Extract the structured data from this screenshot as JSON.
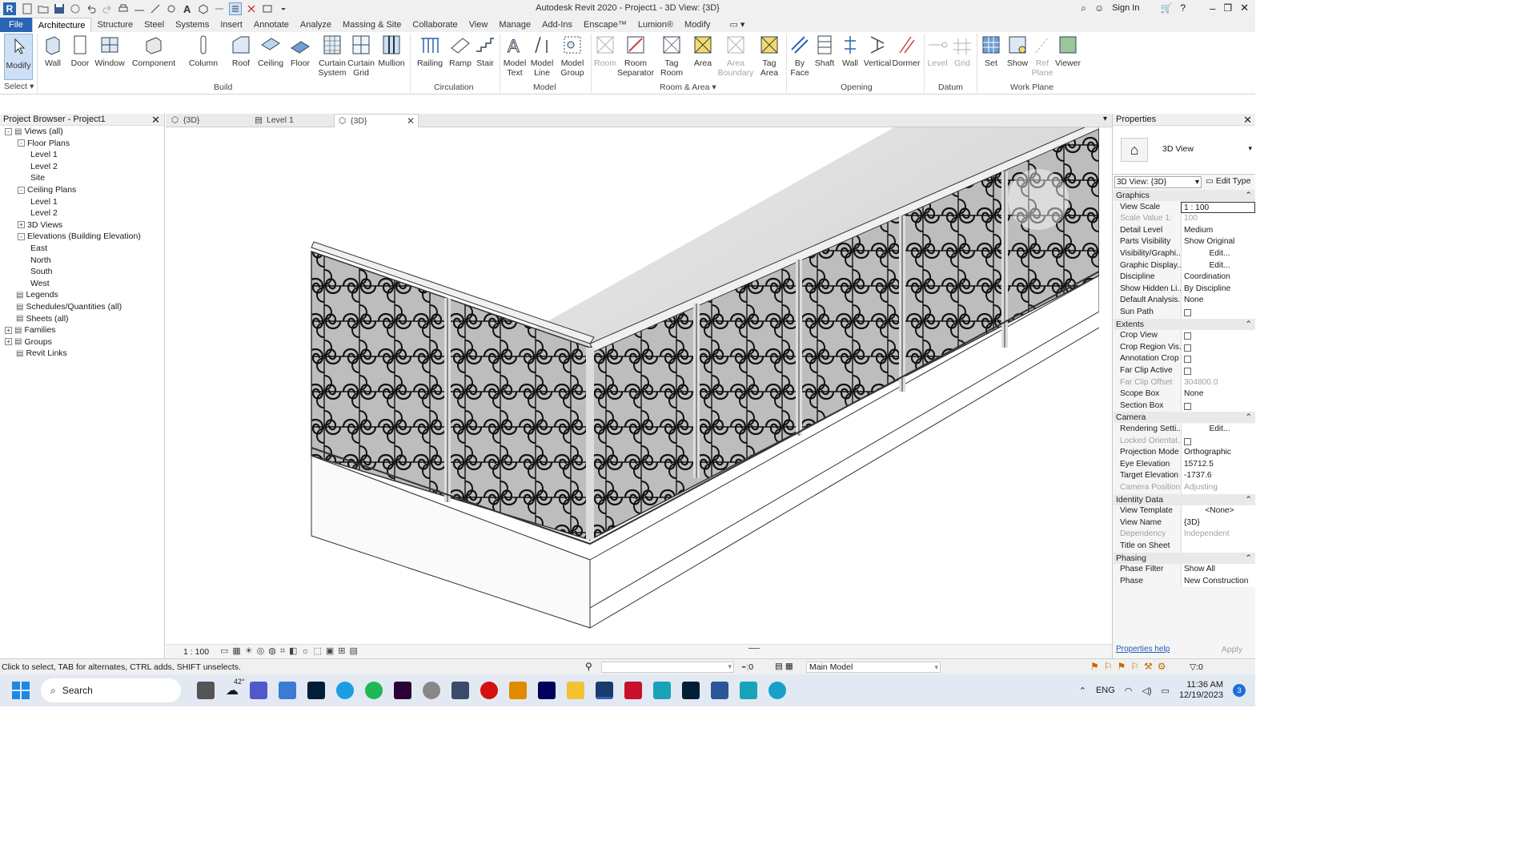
{
  "title_bar": {
    "title": "Autodesk Revit 2020 - Project1 - 3D View: {3D}",
    "sign_in": "Sign In"
  },
  "menu": {
    "tabs": [
      "File",
      "Architecture",
      "Structure",
      "Steel",
      "Systems",
      "Insert",
      "Annotate",
      "Analyze",
      "Massing & Site",
      "Collaborate",
      "View",
      "Manage",
      "Add-Ins",
      "Enscape™",
      "Lumion®",
      "Modify"
    ],
    "active": "Architecture"
  },
  "ribbon": {
    "select": {
      "modify": "Modify",
      "select_label": "Select"
    },
    "build": {
      "label": "Build",
      "items": [
        "Wall",
        "Door",
        "Window",
        "Component",
        "Column",
        "Roof",
        "Ceiling",
        "Floor",
        "Curtain System",
        "Curtain Grid",
        "Mullion"
      ]
    },
    "circulation": {
      "label": "Circulation",
      "items": [
        "Railing",
        "Ramp",
        "Stair"
      ]
    },
    "model": {
      "label": "Model",
      "items": [
        "Model Text",
        "Model Line",
        "Model Group"
      ]
    },
    "room_area": {
      "label": "Room & Area",
      "items": [
        "Room",
        "Room Separator",
        "Tag Room",
        "Area",
        "Area Boundary",
        "Tag Area"
      ]
    },
    "opening": {
      "label": "Opening",
      "items": [
        "By Face",
        "Shaft",
        "Wall",
        "Vertical",
        "Dormer"
      ]
    },
    "datum": {
      "label": "Datum",
      "items": [
        "Level",
        "Grid"
      ]
    },
    "work_plane": {
      "label": "Work Plane",
      "items": [
        "Set",
        "Show",
        "Ref Plane",
        "Viewer"
      ]
    }
  },
  "project_browser": {
    "title": "Project Browser - Project1",
    "tree": [
      {
        "label": "Views (all)",
        "depth": 0,
        "expander": "-"
      },
      {
        "label": "Floor Plans",
        "depth": 1,
        "expander": "-"
      },
      {
        "label": "Level 1",
        "depth": 2
      },
      {
        "label": "Level 2",
        "depth": 2
      },
      {
        "label": "Site",
        "depth": 2
      },
      {
        "label": "Ceiling Plans",
        "depth": 1,
        "expander": "-"
      },
      {
        "label": "Level 1",
        "depth": 2
      },
      {
        "label": "Level 2",
        "depth": 2
      },
      {
        "label": "3D Views",
        "depth": 1,
        "expander": "+"
      },
      {
        "label": "Elevations (Building Elevation)",
        "depth": 1,
        "expander": "-"
      },
      {
        "label": "East",
        "depth": 2
      },
      {
        "label": "North",
        "depth": 2
      },
      {
        "label": "South",
        "depth": 2
      },
      {
        "label": "West",
        "depth": 2
      },
      {
        "label": "Legends",
        "depth": 0
      },
      {
        "label": "Schedules/Quantities (all)",
        "depth": 0
      },
      {
        "label": "Sheets (all)",
        "depth": 0
      },
      {
        "label": "Families",
        "depth": 0,
        "expander": "+"
      },
      {
        "label": "Groups",
        "depth": 0,
        "expander": "+"
      },
      {
        "label": "Revit Links",
        "depth": 0
      }
    ]
  },
  "view_tabs": [
    {
      "label": "{3D}"
    },
    {
      "label": "Level 1"
    },
    {
      "label": "{3D}",
      "active": true
    }
  ],
  "view_control": {
    "scale": "1 : 100",
    "count": "0"
  },
  "properties": {
    "title": "Properties",
    "type_name": "3D View",
    "selector": "3D View: {3D}",
    "edit_type": "Edit Type",
    "sections": [
      {
        "name": "Graphics",
        "rows": [
          {
            "k": "View Scale",
            "v": "1 : 100"
          },
          {
            "k": "Scale Value    1:",
            "v": "100",
            "dim": true
          },
          {
            "k": "Detail Level",
            "v": "Medium"
          },
          {
            "k": "Parts Visibility",
            "v": "Show Original"
          },
          {
            "k": "Visibility/Graphi...",
            "v": "Edit..."
          },
          {
            "k": "Graphic Display...",
            "v": "Edit..."
          },
          {
            "k": "Discipline",
            "v": "Coordination"
          },
          {
            "k": "Show Hidden Li...",
            "v": "By Discipline"
          },
          {
            "k": "Default Analysis...",
            "v": "None"
          },
          {
            "k": "Sun Path",
            "checkbox": true
          }
        ]
      },
      {
        "name": "Extents",
        "rows": [
          {
            "k": "Crop View",
            "checkbox": true
          },
          {
            "k": "Crop Region Vis...",
            "checkbox": true
          },
          {
            "k": "Annotation Crop",
            "checkbox": true
          },
          {
            "k": "Far Clip Active",
            "checkbox": true
          },
          {
            "k": "Far Clip Offset",
            "v": "304800.0",
            "dim": true
          },
          {
            "k": "Scope Box",
            "v": "None"
          },
          {
            "k": "Section Box",
            "checkbox": true
          }
        ]
      },
      {
        "name": "Camera",
        "rows": [
          {
            "k": "Rendering Setti...",
            "v": "Edit..."
          },
          {
            "k": "Locked Orientat...",
            "checkbox": true,
            "dim": true
          },
          {
            "k": "Projection Mode",
            "v": "Orthographic"
          },
          {
            "k": "Eye Elevation",
            "v": "15712.5"
          },
          {
            "k": "Target Elevation",
            "v": "-1737.6"
          },
          {
            "k": "Camera Position",
            "v": "Adjusting",
            "dim": true
          }
        ]
      },
      {
        "name": "Identity Data",
        "rows": [
          {
            "k": "View Template",
            "v": "<None>"
          },
          {
            "k": "View Name",
            "v": "{3D}"
          },
          {
            "k": "Dependency",
            "v": "Independent",
            "dim": true
          },
          {
            "k": "Title on Sheet",
            "v": ""
          }
        ]
      },
      {
        "name": "Phasing",
        "rows": [
          {
            "k": "Phase Filter",
            "v": "Show All"
          },
          {
            "k": "Phase",
            "v": "New Construction"
          }
        ]
      }
    ],
    "help_link": "Properties help",
    "apply": "Apply"
  },
  "status_bar": {
    "hint": "Click to select, TAB for alternates, CTRL adds, SHIFT unselects.",
    "counter": ":0",
    "model": "Main Model",
    "filter_count": ":0"
  },
  "taskbar": {
    "search": "Search",
    "weather": "42°",
    "lang": "ENG",
    "time": "11:36 AM",
    "date": "12/19/2023",
    "notif": "3"
  },
  "colors": {
    "accent": "#2a64b4",
    "ribbon_bg": "#ffffff",
    "panel_bg": "#f0f0f0"
  }
}
